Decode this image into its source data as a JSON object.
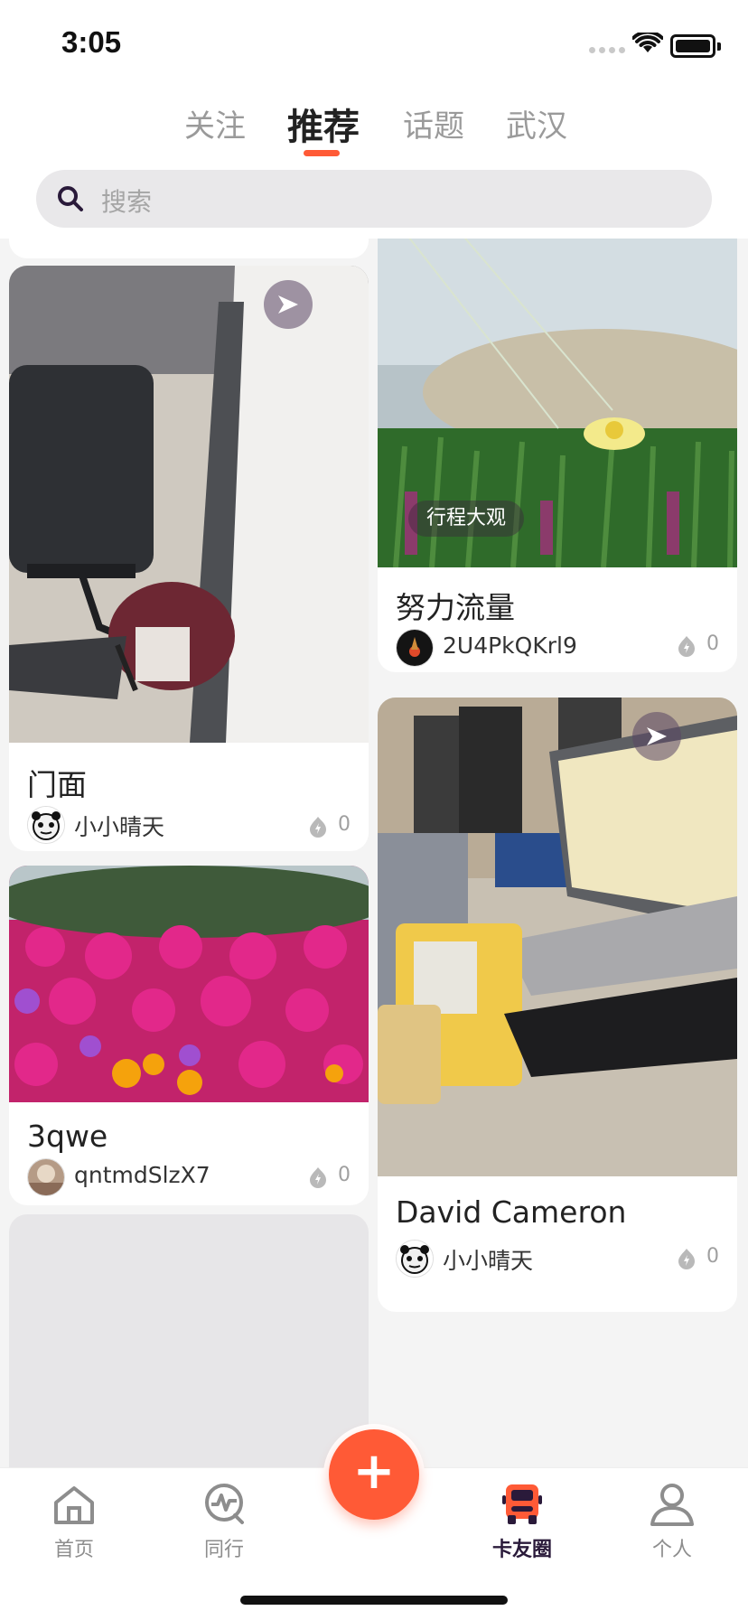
{
  "status_bar": {
    "time": "3:05"
  },
  "top_tabs": [
    {
      "label": "关注"
    },
    {
      "label": "推荐"
    },
    {
      "label": "话题"
    },
    {
      "label": "武汉"
    }
  ],
  "search": {
    "placeholder": "搜索"
  },
  "feed": {
    "left": [
      {
        "title": "门面",
        "author": "小小晴天",
        "likes": "0",
        "type": "video"
      },
      {
        "title": "3qwe",
        "author": "qntmdSlzX7",
        "likes": "0",
        "type": "image"
      }
    ],
    "right": [
      {
        "title": "努力流量",
        "author": "2U4PkQKrl9",
        "likes": "0",
        "type": "image",
        "tag": "行程大观"
      },
      {
        "title": "David Cameron",
        "author": "小小晴天",
        "likes": "0",
        "type": "video"
      }
    ]
  },
  "bottom_nav": [
    {
      "label": "首页",
      "icon": "home-icon"
    },
    {
      "label": "同行",
      "icon": "activity-icon"
    },
    {
      "label": "卡友圈",
      "icon": "truck-icon",
      "active": true
    },
    {
      "label": "个人",
      "icon": "person-icon"
    }
  ],
  "colors": {
    "accent": "#ff5a36",
    "active_nav": "#2a1a3a"
  }
}
